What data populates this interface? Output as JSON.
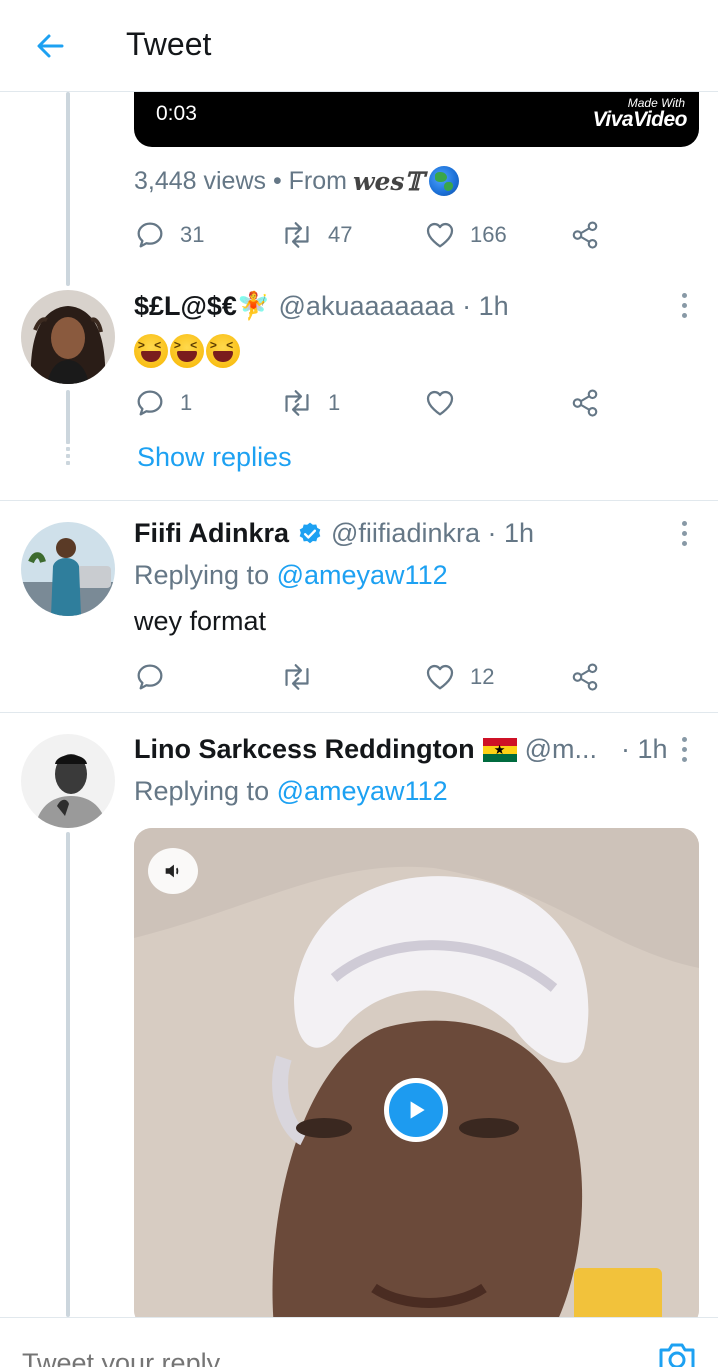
{
  "header": {
    "title": "Tweet"
  },
  "video": {
    "time": "0:03",
    "watermark_small": "Made With",
    "watermark_large": "VivaVideo"
  },
  "stats": {
    "views": "3,448 views • From",
    "source": "wes𝕋"
  },
  "main_actions": {
    "replies": "31",
    "retweets": "47",
    "likes": "166"
  },
  "tweets": [
    {
      "name": "$£L@$€🧚",
      "handle": "@akuaaaaaaa · 1h",
      "replies": "1",
      "retweets": "1",
      "likes": "",
      "show_replies": "Show replies"
    },
    {
      "name": "Fiifi Adinkra",
      "handle": "@fiifiadinkra · 1h",
      "replying_label": "Replying to",
      "replying_to": "@ameyaw112",
      "text": "wey format",
      "replies": "",
      "retweets": "",
      "likes": "12"
    },
    {
      "name": "Lino Sarkcess Reddington",
      "handle": "@m...",
      "time": "· 1h",
      "replying_label": "Replying to",
      "replying_to": "@ameyaw112"
    }
  ],
  "reply_bar": {
    "placeholder": "Tweet your reply"
  },
  "colors": {
    "accent": "#1da1f2",
    "muted": "#657786",
    "divider": "#e1e8ed"
  }
}
